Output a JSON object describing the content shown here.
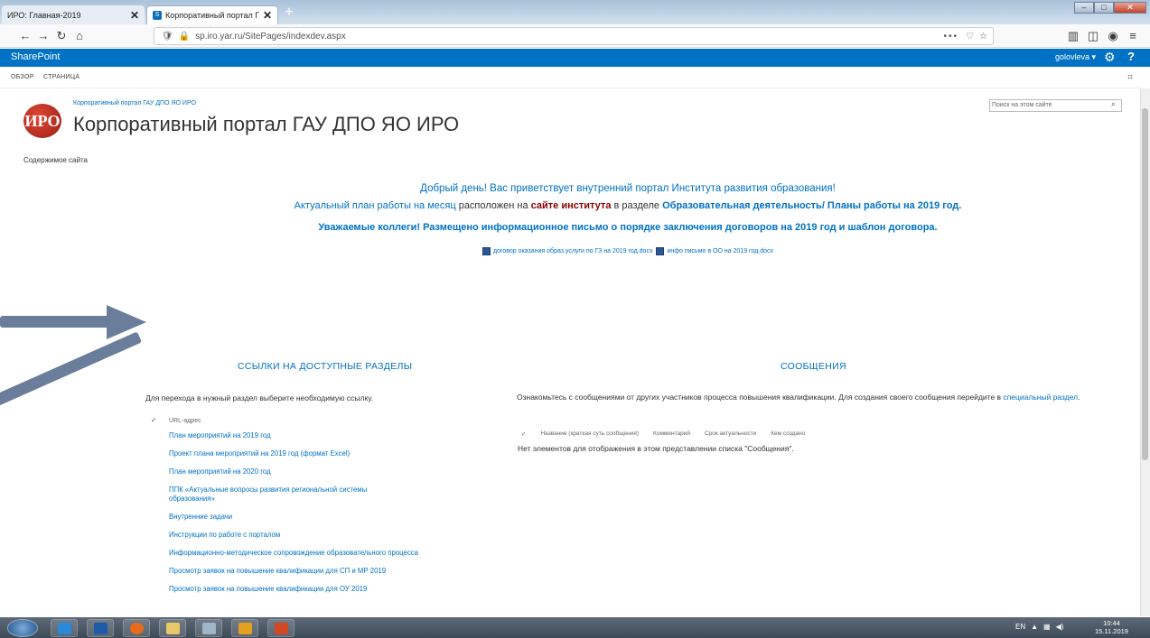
{
  "browser": {
    "tabs": [
      {
        "title": "ИРО: Главная-2019"
      },
      {
        "title": "Корпоративный портал ГАУ Д"
      }
    ],
    "url": "sp.iro.yar.ru/SitePages/indexdev.aspx"
  },
  "sharepoint": {
    "brand": "SharePoint",
    "user": "golovleva ▾"
  },
  "ribbon": {
    "tabs": [
      "ОБЗОР",
      "СТРАНИЦА"
    ]
  },
  "site": {
    "logo_text": "ИРО",
    "breadcrumb": "Корпоративный портал ГАУ ДПО ЯО ИРО",
    "title": "Корпоративный портал ГАУ ДПО ЯО ИРО",
    "search_placeholder": "Поиск на этом сайте",
    "quick_launch": "Содержимое сайта"
  },
  "main": {
    "welcome": "Добрый день! Вас приветствует внутренний портал Института развития образования!",
    "plan": {
      "link1": "Актуальный план работы на месяц",
      "text1": " расположен на ",
      "link2": "сайте института",
      "text2": " в разделе ",
      "link3": "Образовательная деятельность/ Планы работы на 2019 год."
    },
    "notice": "Уважаемые коллеги! Размещено информационное письмо о порядке заключения договоров на 2019 год и шаблон договора.",
    "docs": [
      "договор оказания образ.услуги по ГЗ на 2019 год.docx",
      "инфо письмо в ОО на 2019 год.docx"
    ]
  },
  "links_section": {
    "heading": "ССЫЛКИ НА ДОСТУПНЫЕ РАЗДЕЛЫ",
    "subtitle": "Для перехода в нужный раздел выберите необходимую ссылку.",
    "column_header": "URL-адрес",
    "items": [
      "План мероприятий на 2019 год",
      "Проект плана мероприятий на 2019 год (формат Excel)",
      "План мероприятий на 2020 год",
      "ППК «Актуальные вопросы развития региональной системы образования»",
      "Внутренние задачи",
      "Инструкции по работе с порталом",
      "Информационно-методическое сопровождение образовательного процесса",
      "Просмотр заявок на повышение квалификации для СП и МР 2019",
      "Просмотр заявок на повышение квалификации для ОУ 2019"
    ]
  },
  "messages_section": {
    "heading": "СООБЩЕНИЯ",
    "subtitle": "Ознакомьтесь с сообщениями от других участников процесса повышения квалификации. Для создания своего сообщения перейдите в",
    "subtitle_link": "специальный раздел",
    "columns": [
      "Название (краткая суть сообщения)",
      "Комментарий",
      "Срок актуальности",
      "Кем создано"
    ],
    "empty_text": "Нет элементов для отображения в этом представлении списка \"Сообщения\"."
  },
  "taskbar": {
    "lang": "EN",
    "time": "10:44",
    "date": "15.11.2019"
  }
}
